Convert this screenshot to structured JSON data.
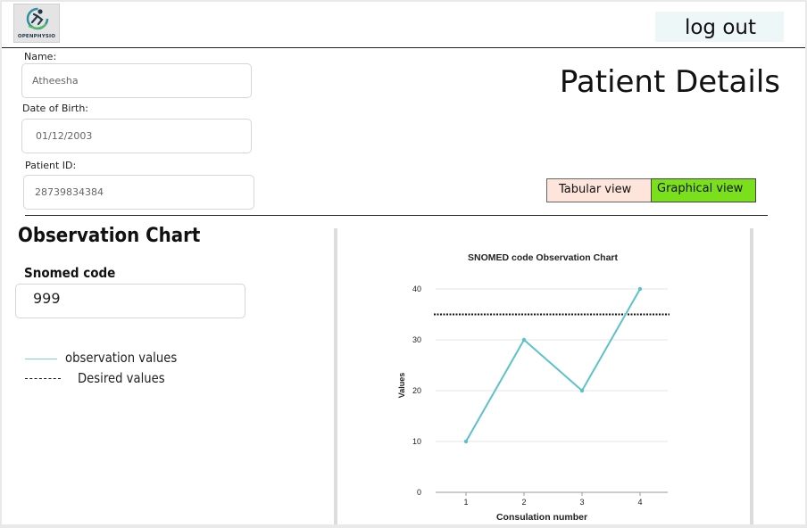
{
  "brand": {
    "logo_text": "OPENPHYSIO"
  },
  "header": {
    "logout_label": "log out"
  },
  "patient": {
    "name_label": "Name:",
    "name_value": "Atheesha",
    "dob_label": "Date of Birth:",
    "dob_value": "01/12/2003",
    "id_label": "Patient ID:",
    "id_value": "28739834384"
  },
  "page_title": "Patient Details",
  "views": {
    "tabular_label": "Tabular view",
    "graphical_label": "Graphical view",
    "selected": "Graphical view"
  },
  "observation": {
    "title": "Observation Chart",
    "snomed_label": "Snomed code",
    "snomed_value": "999",
    "legend": [
      {
        "label": "observation values",
        "style": "solid",
        "color": "#7fcfd6"
      },
      {
        "label": "Desired values",
        "style": "dotted",
        "color": "#111111"
      }
    ]
  },
  "colors": {
    "accent_green": "#7ae01c",
    "tab_pink": "#fde5dc",
    "line_teal": "#5bc2c9"
  },
  "chart_data": {
    "type": "line",
    "title": "SNOMED code Observation Chart",
    "xlabel": "Consulation number",
    "ylabel": "Values",
    "x": [
      1,
      2,
      3,
      4
    ],
    "series": [
      {
        "values": [
          10,
          30,
          20,
          40
        ]
      }
    ],
    "reference_line": {
      "value": 35,
      "style": "dotted"
    },
    "ylim": [
      0,
      40
    ],
    "yticks": [
      0,
      10,
      20,
      30,
      40
    ],
    "grid": true
  }
}
